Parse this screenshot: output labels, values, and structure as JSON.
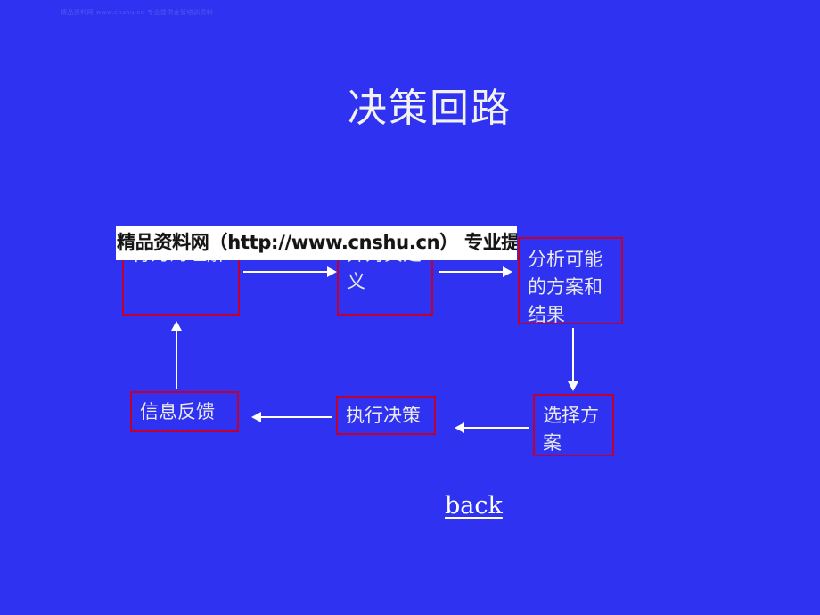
{
  "slide": {
    "background_color": "#2f32f0",
    "title": "决策回路",
    "faint_header": "精品资料网 www.cnshu.cn 专业提供企管培训资料",
    "back_link": "back"
  },
  "watermark": {
    "text": "精品资料网（http://www.cnshu.cn） 专业提供企管培训资料",
    "band_color": "#ffffff",
    "text_color": "#151515"
  },
  "diagram": {
    "border_color": "#c00030",
    "arrow_color": "#ffffff",
    "text_color": "#e9e9ee",
    "nodes": [
      {
        "id": "understand",
        "label": "行为的理解"
      },
      {
        "id": "define",
        "label": "并对其定义"
      },
      {
        "id": "analyze",
        "label": "分析可能的方案和结果"
      },
      {
        "id": "select",
        "label": "选择方案"
      },
      {
        "id": "execute",
        "label": "执行决策"
      },
      {
        "id": "feedback",
        "label": "信息反馈"
      }
    ],
    "arrows": [
      {
        "id": "understand-to-define",
        "direction": "right"
      },
      {
        "id": "define-to-analyze",
        "direction": "right"
      },
      {
        "id": "analyze-to-select",
        "direction": "down"
      },
      {
        "id": "select-to-execute",
        "direction": "left"
      },
      {
        "id": "execute-to-feedback",
        "direction": "left"
      },
      {
        "id": "feedback-to-understand",
        "direction": "up"
      }
    ]
  }
}
